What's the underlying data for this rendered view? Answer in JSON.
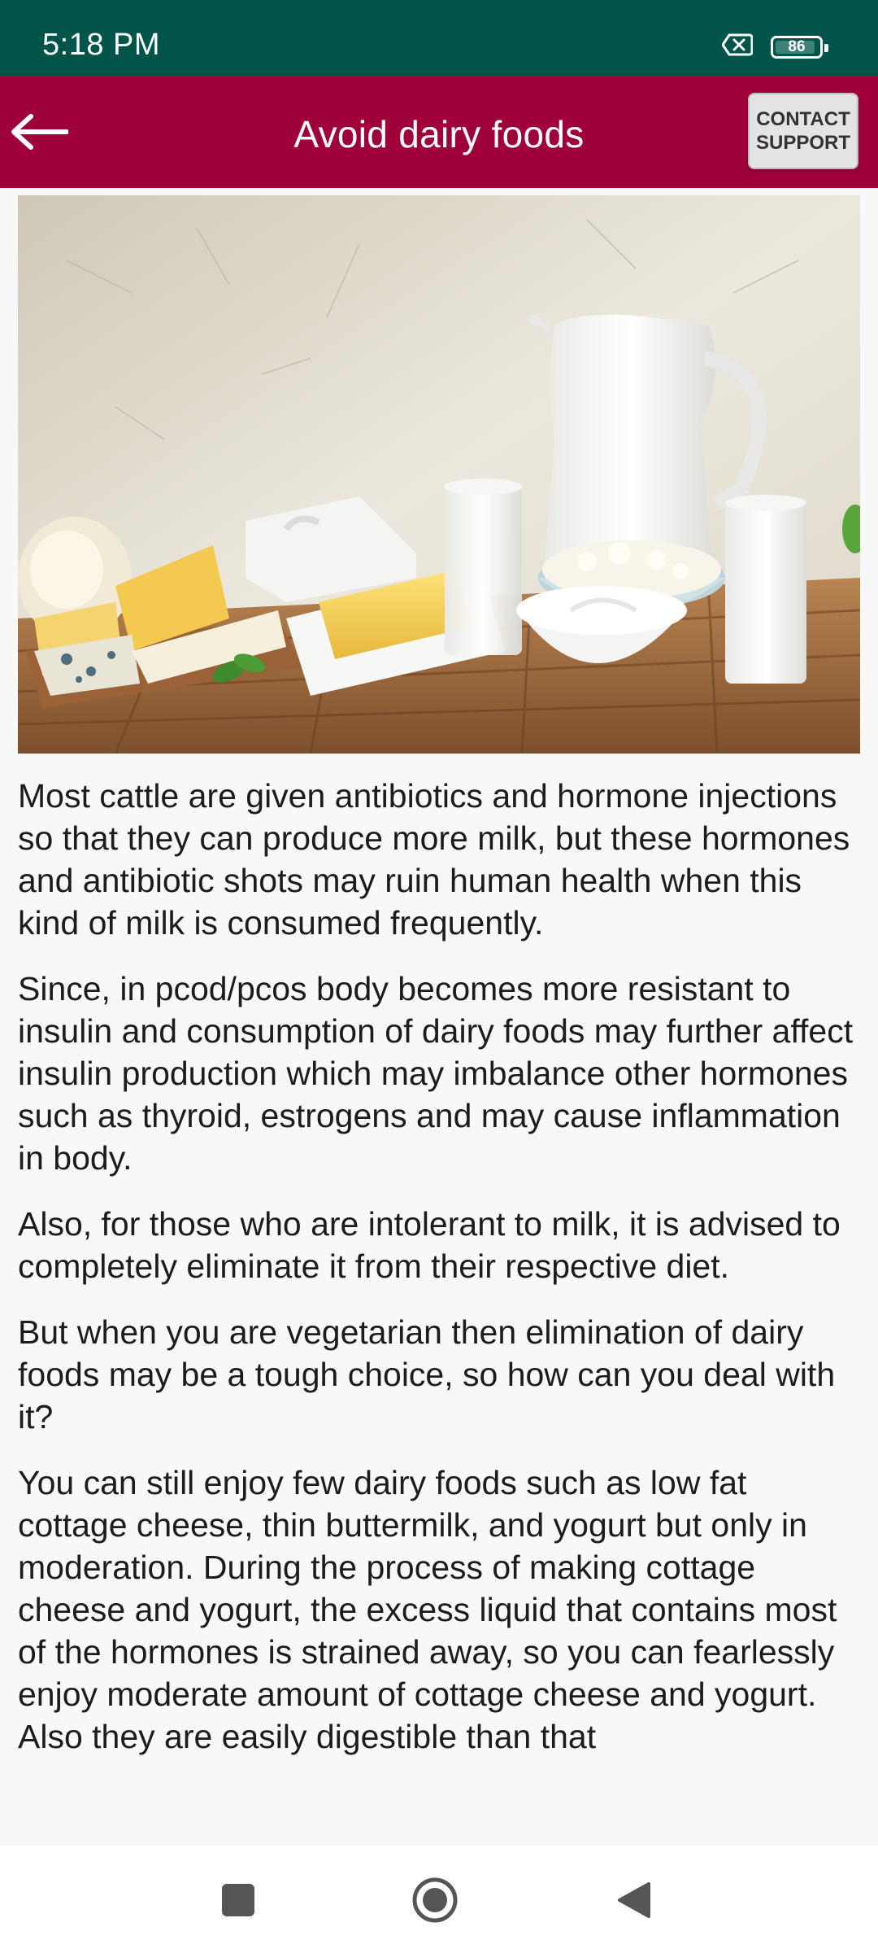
{
  "status_bar": {
    "time": "5:18 PM",
    "battery_level": "86",
    "icons": [
      "no-sim-icon",
      "battery-icon"
    ]
  },
  "header": {
    "title": "Avoid dairy foods",
    "back_icon": "arrow-left-icon",
    "contact_label_line1": "CONTACT",
    "contact_label_line2": "SUPPORT"
  },
  "article": {
    "image_subject": "dairy-products-image",
    "paragraphs": [
      "Most cattle are given antibiotics and hormone injections so that they can produce more milk, but these hormones and antibiotic shots may ruin human health when this kind of milk is consumed frequently.",
      "Since, in pcod/pcos body becomes more resistant to insulin and consumption of dairy foods may further affect insulin production which may imbalance other hormones such as thyroid, estrogens and may cause inflammation in body.",
      "Also, for those who are intolerant to milk, it is advised to completely eliminate it from their respective diet.",
      "But when you are vegetarian then elimination of dairy foods may be a tough choice, so how can you deal with it?",
      "You can still enjoy few dairy foods such as low fat cottage cheese, thin buttermilk, and yogurt but only in moderation. During the process of making cottage cheese and yogurt, the excess liquid that contains most of the hormones is strained away, so you can fearlessly enjoy moderate amount of cottage cheese and yogurt. Also they are easily digestible than that"
    ]
  },
  "nav_bar": {
    "icons": [
      "recents-square-icon",
      "home-circle-icon",
      "back-triangle-icon"
    ]
  },
  "colors": {
    "status_bar": "#005449",
    "app_bar": "#a0003a",
    "background": "#f8f8f8"
  }
}
